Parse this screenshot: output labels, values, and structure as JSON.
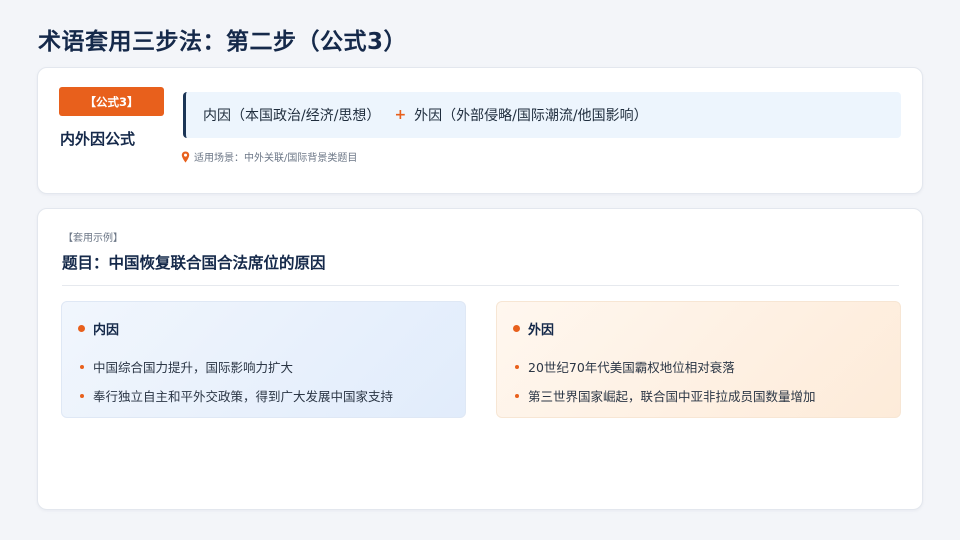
{
  "page": {
    "title": "术语套用三步法：第二步（公式3）"
  },
  "formula": {
    "tag": "【公式3】",
    "name": "内外因公式",
    "part_inner": "内因（本国政治/经济/思想）",
    "plus": "+",
    "part_outer": "外因（外部侵略/国际潮流/他国影响）",
    "scene": "适用场景：中外关联/国际背景类题目"
  },
  "example": {
    "tag": "【套用示例】",
    "question": "题目：中国恢复联合国合法席位的原因",
    "inner": {
      "title": "内因",
      "items": [
        "中国综合国力提升，国际影响力扩大",
        "奉行独立自主和平外交政策，得到广大发展中国家支持"
      ]
    },
    "outer": {
      "title": "外因",
      "items": [
        "20世纪70年代美国霸权地位相对衰落",
        "第三世界国家崛起，联合国中亚非拉成员国数量增加"
      ]
    }
  },
  "colors": {
    "accent": "#e8601c",
    "navy": "#15294a",
    "inner_panel": "#e8f0fc",
    "outer_panel": "#fef1e4"
  },
  "icons": {
    "scene": "location-pin-icon"
  }
}
